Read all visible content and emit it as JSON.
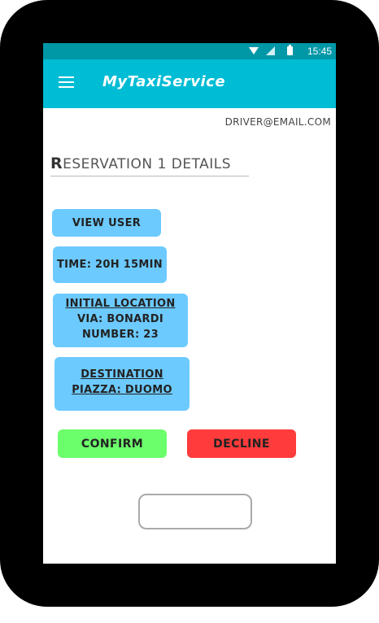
{
  "status_bar": {
    "time": "15:45",
    "icons": [
      "wifi-icon",
      "signal-icon",
      "battery-icon"
    ]
  },
  "app_bar": {
    "title": "MyTaxiService",
    "menu_icon": "hamburger-menu-icon"
  },
  "user": {
    "email": "driver@email.com"
  },
  "page": {
    "heading_first": "R",
    "heading_rest": "eservation 1 details"
  },
  "cards": {
    "view_user": "View user",
    "time": "Time: 20h 15min",
    "initial_location": {
      "title": "Initial location",
      "street": "Via: Bonardi",
      "number": "Number: 23"
    },
    "destination": {
      "title": "Destination",
      "place": "Piazza: Duomo"
    }
  },
  "actions": {
    "confirm": "Confirm",
    "decline": "Decline"
  },
  "colors": {
    "app_bar": "#00bcd4",
    "status_bar": "#0097a7",
    "card": "#6ccaff",
    "confirm": "#6cff6c",
    "decline": "#ff3b3b"
  }
}
